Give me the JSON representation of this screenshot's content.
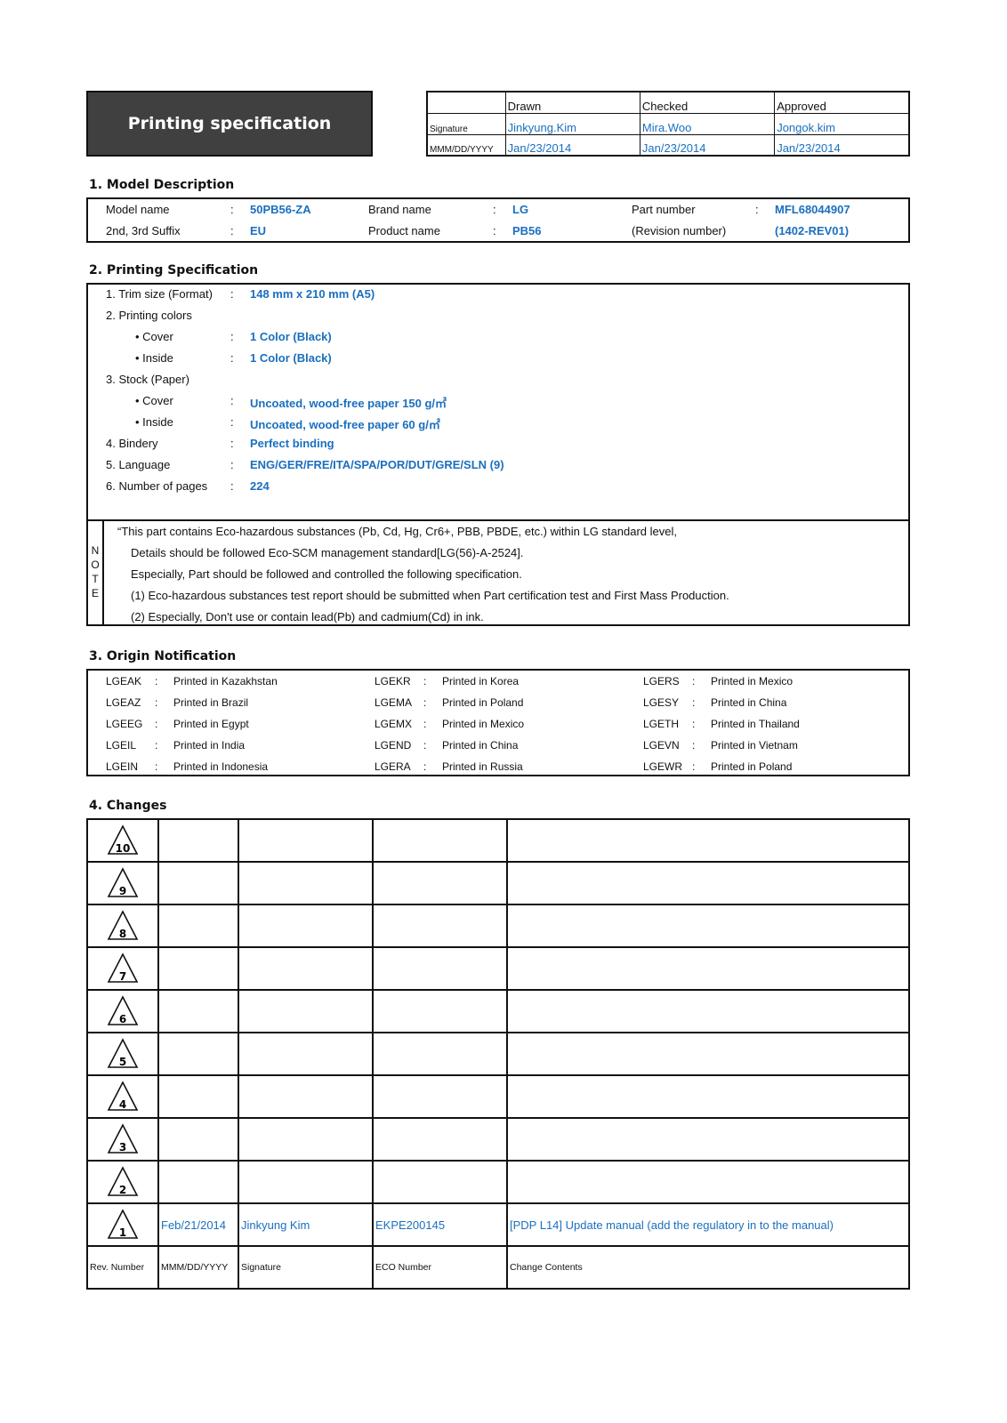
{
  "header": {
    "title": "Printing specification",
    "approval": {
      "columns": [
        "Drawn",
        "Checked",
        "Approved"
      ],
      "signature_label": "Signature",
      "date_label": "MMM/DD/YYYY",
      "signatures": [
        "Jinkyung.Kim",
        "Mira.Woo",
        "Jongok.kim"
      ],
      "dates": [
        "Jan/23/2014",
        "Jan/23/2014",
        "Jan/23/2014"
      ]
    }
  },
  "model_description": {
    "title": "1. Model Description",
    "colon": ":",
    "rows": [
      [
        {
          "label": "Model name",
          "value": "50PB56-ZA"
        },
        {
          "label": "Brand name",
          "value": "LG"
        },
        {
          "label": "Part number",
          "value": "MFL68044907"
        }
      ],
      [
        {
          "label": "2nd, 3rd Suffix",
          "value": "EU"
        },
        {
          "label": "Product name",
          "value": "PB56"
        },
        {
          "label": "(Revision number)",
          "value": "(1402-REV01)"
        }
      ]
    ]
  },
  "printing_spec": {
    "title": "2. Printing Specification",
    "colon": ":",
    "items": [
      {
        "label": "1. Trim size (Format)",
        "value": "148 mm x 210 mm (A5)"
      },
      {
        "label": "2. Printing colors",
        "value": ""
      },
      {
        "label": "• Cover",
        "value": "1 Color (Black)"
      },
      {
        "label": "• Inside",
        "value": "1 Color (Black)"
      },
      {
        "label": "3. Stock (Paper)",
        "value": ""
      },
      {
        "label": "• Cover",
        "value": "Uncoated, wood-free paper 150 g/㎡"
      },
      {
        "label": "• Inside",
        "value": "Uncoated, wood-free paper 60 g/㎡"
      },
      {
        "label": "4. Bindery",
        "value": "Perfect binding"
      },
      {
        "label": "5. Language",
        "value": "ENG/GER/FRE/ITA/SPA/POR/DUT/GRE/SLN (9)"
      },
      {
        "label": "6. Number of pages",
        "value": "224"
      }
    ],
    "note": {
      "label_letters": [
        "N",
        "O",
        "T",
        "E"
      ],
      "lines": [
        "“This part contains Eco-hazardous substances (Pb, Cd, Hg, Cr6+, PBB, PBDE, etc.) within LG standard level,",
        "Details should be followed Eco-SCM management standard[LG(56)-A-2524].",
        "Especially, Part should be followed and controlled the following specification.",
        "(1) Eco-hazardous substances test report should be submitted when Part certification test and First Mass Production.",
        "(2) Especially, Don't use or contain lead(Pb) and cadmium(Cd) in ink."
      ]
    }
  },
  "origin": {
    "title": "3. Origin Notification",
    "colon": ":",
    "columns": [
      [
        {
          "code": "LGEAK",
          "text": "Printed in Kazakhstan"
        },
        {
          "code": "LGEAZ",
          "text": "Printed in Brazil"
        },
        {
          "code": "LGEEG",
          "text": "Printed in Egypt"
        },
        {
          "code": "LGEIL",
          "text": "Printed in India"
        },
        {
          "code": "LGEIN",
          "text": "Printed in Indonesia"
        }
      ],
      [
        {
          "code": "LGEKR",
          "text": "Printed in Korea"
        },
        {
          "code": "LGEMA",
          "text": "Printed in Poland"
        },
        {
          "code": "LGEMX",
          "text": "Printed in Mexico"
        },
        {
          "code": "LGEND",
          "text": "Printed in China"
        },
        {
          "code": "LGERA",
          "text": "Printed in Russia"
        }
      ],
      [
        {
          "code": "LGERS",
          "text": "Printed in Mexico"
        },
        {
          "code": "LGESY",
          "text": "Printed in China"
        },
        {
          "code": "LGETH",
          "text": "Printed in Thailand"
        },
        {
          "code": "LGEVN",
          "text": "Printed in Vietnam"
        },
        {
          "code": "LGEWR",
          "text": "Printed in Poland"
        }
      ]
    ]
  },
  "changes": {
    "title": "4. Changes",
    "rows": [
      {
        "rev": "10",
        "date": "",
        "signature": "",
        "eco": "",
        "contents": ""
      },
      {
        "rev": "9",
        "date": "",
        "signature": "",
        "eco": "",
        "contents": ""
      },
      {
        "rev": "8",
        "date": "",
        "signature": "",
        "eco": "",
        "contents": ""
      },
      {
        "rev": "7",
        "date": "",
        "signature": "",
        "eco": "",
        "contents": ""
      },
      {
        "rev": "6",
        "date": "",
        "signature": "",
        "eco": "",
        "contents": ""
      },
      {
        "rev": "5",
        "date": "",
        "signature": "",
        "eco": "",
        "contents": ""
      },
      {
        "rev": "4",
        "date": "",
        "signature": "",
        "eco": "",
        "contents": ""
      },
      {
        "rev": "3",
        "date": "",
        "signature": "",
        "eco": "",
        "contents": ""
      },
      {
        "rev": "2",
        "date": "",
        "signature": "",
        "eco": "",
        "contents": ""
      },
      {
        "rev": "1",
        "date": "Feb/21/2014",
        "signature": "Jinkyung Kim",
        "eco": "EKPE200145",
        "contents": "[PDP L14] Update manual (add the regulatory in to the manual)"
      }
    ],
    "footer": [
      "Rev. Number",
      "MMM/DD/YYYY",
      "Signature",
      "ECO Number",
      "Change Contents"
    ]
  },
  "colors": {
    "value_blue": "#1a6fbf",
    "title_box_bg": "#404040"
  }
}
